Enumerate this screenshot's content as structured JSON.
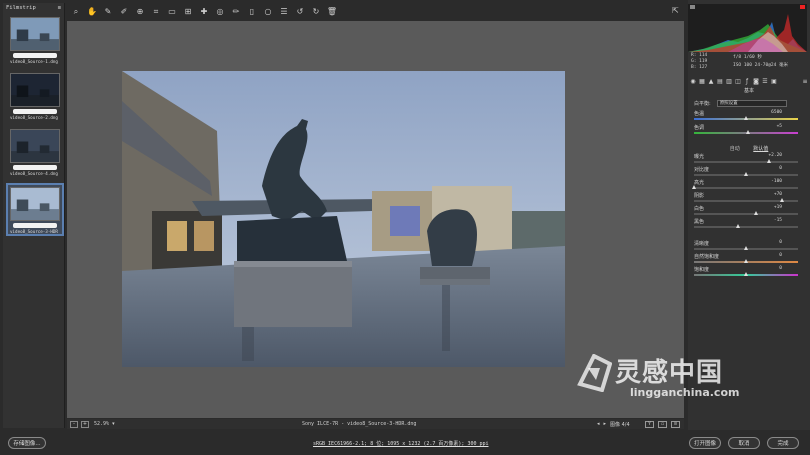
{
  "filmstrip": {
    "title": "Filmstrip",
    "items": [
      {
        "name": "video8_Source-1.dng",
        "selected": false
      },
      {
        "name": "video8_Source-2.dng",
        "selected": false
      },
      {
        "name": "video8_Source-4.dng",
        "selected": false
      },
      {
        "name": "video8_Source-3-HDR",
        "selected": true
      }
    ]
  },
  "toolbar": {
    "tools": [
      "zoom-icon",
      "hand-icon",
      "white-balance-icon",
      "color-sampler-icon",
      "target-adjust-icon",
      "crop-icon",
      "straighten-icon",
      "transform-icon",
      "spot-removal-icon",
      "red-eye-icon",
      "adjustment-brush-icon",
      "graduated-filter-icon",
      "radial-filter-icon",
      "preferences-icon",
      "rotate-left-icon",
      "rotate-right-icon",
      "trash-icon"
    ],
    "fullscreen_icon": "fullscreen-icon"
  },
  "status": {
    "zoom": "52.9%",
    "filename": "Sony ILCE-7R - video8_Source-3-HDR.dng",
    "image_counter": "图像 4/4",
    "buttons": [
      "-",
      "+"
    ]
  },
  "bottom": {
    "save_button": "存储图像...",
    "workflow": "sRGB IEC61966-2.1; 8 位; 1095 x 1232 (2.7 百万像素); 300 ppi",
    "open_button": "打开图像",
    "cancel_button": "取消",
    "done_button": "完成"
  },
  "histogram": {
    "rgb": [
      "R: 114",
      "G: 119",
      "B: 127"
    ],
    "camera": [
      "f/8  1/60 秒",
      "ISO 100  24-70@24 毫米"
    ]
  },
  "panel": {
    "title": "基本",
    "wb_label": "白平衡:",
    "wb_value": "原照设置",
    "auto": "自动",
    "default": "默认值",
    "sliders": [
      {
        "label": "色温",
        "value": "6500",
        "pos": 0.5
      },
      {
        "label": "色调",
        "value": "+5",
        "pos": 0.52
      },
      {
        "label": "曝光",
        "value": "+2.20",
        "pos": 0.72
      },
      {
        "label": "对比度",
        "value": "0",
        "pos": 0.5
      },
      {
        "label": "高光",
        "value": "-100",
        "pos": 0.0
      },
      {
        "label": "阴影",
        "value": "+70",
        "pos": 0.85
      },
      {
        "label": "白色",
        "value": "+19",
        "pos": 0.6
      },
      {
        "label": "黑色",
        "value": "-15",
        "pos": 0.42
      },
      {
        "label": "清晰度",
        "value": "0",
        "pos": 0.5
      },
      {
        "label": "自然饱和度",
        "value": "0",
        "pos": 0.5
      },
      {
        "label": "饱和度",
        "value": "0",
        "pos": 0.5
      }
    ]
  },
  "watermark": {
    "cn": "灵感中国",
    "en": "lingganchina.com"
  }
}
